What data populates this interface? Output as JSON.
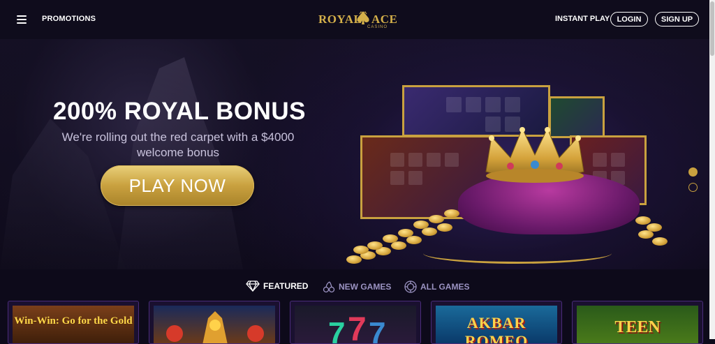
{
  "header": {
    "promotions_label": "PROMOTIONS",
    "logo": {
      "left": "ROYAL",
      "right": "ACE",
      "sub": "CASINO"
    },
    "instant_play_label": "INSTANT PLAY",
    "login_label": "LOGIN",
    "signup_label": "SIGN UP"
  },
  "hero": {
    "title": "200% ROYAL BONUS",
    "subtitle": "We're rolling out the red carpet with a $4000 welcome bonus",
    "cta_label": "PLAY NOW",
    "slides_count": 2,
    "active_slide": 1
  },
  "tabs": [
    {
      "label": "FEATURED",
      "icon": "diamond-icon",
      "active": true
    },
    {
      "label": "NEW GAMES",
      "icon": "cherries-icon",
      "active": false
    },
    {
      "label": "ALL GAMES",
      "icon": "chip-icon",
      "active": false
    }
  ],
  "games": [
    {
      "title": "Win-Win: Go for the Gold"
    },
    {
      "title": ""
    },
    {
      "title": ""
    },
    {
      "title": "AKBAR ROMEO"
    },
    {
      "title": "TEEN"
    }
  ],
  "colors": {
    "accent": "#c9a13f",
    "background": "#0d0a1a",
    "tab_inactive": "#9b93c2"
  }
}
